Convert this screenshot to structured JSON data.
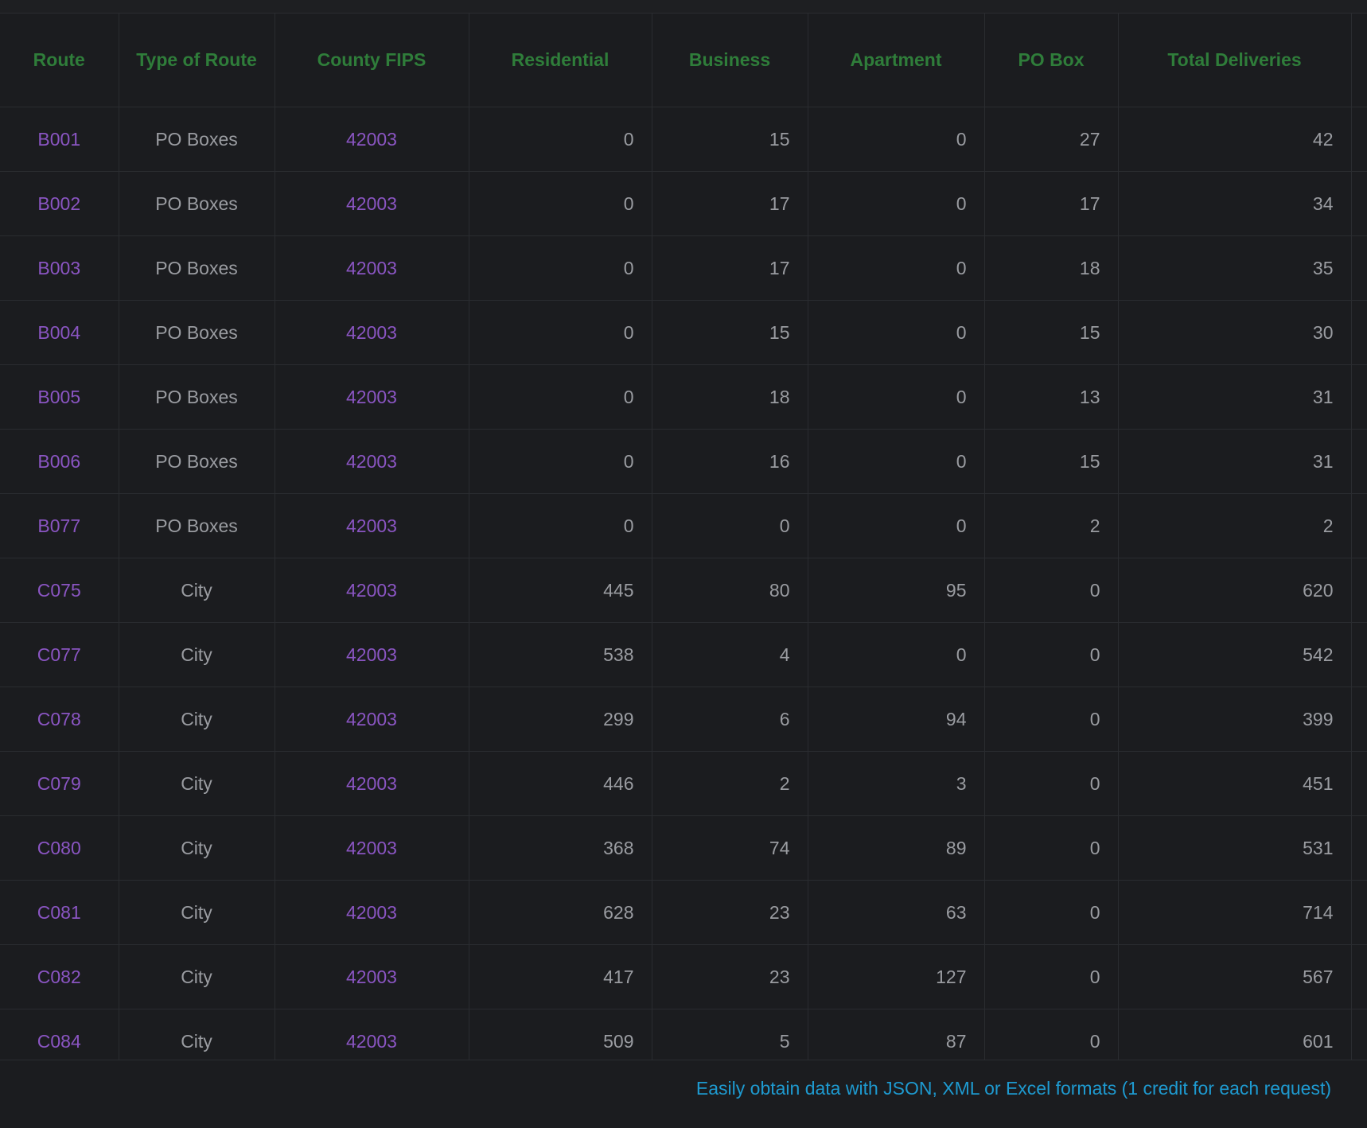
{
  "table": {
    "headers": {
      "route": "Route",
      "type_of_route": "Type of Route",
      "county_fips": "County FIPS",
      "residential": "Residential",
      "business": "Business",
      "apartment": "Apartment",
      "po_box": "PO Box",
      "total_deliveries": "Total Deliveries"
    },
    "rows": [
      {
        "route": "B001",
        "type": "PO Boxes",
        "fips": "42003",
        "residential": "0",
        "business": "15",
        "apartment": "0",
        "po_box": "27",
        "total": "42"
      },
      {
        "route": "B002",
        "type": "PO Boxes",
        "fips": "42003",
        "residential": "0",
        "business": "17",
        "apartment": "0",
        "po_box": "17",
        "total": "34"
      },
      {
        "route": "B003",
        "type": "PO Boxes",
        "fips": "42003",
        "residential": "0",
        "business": "17",
        "apartment": "0",
        "po_box": "18",
        "total": "35"
      },
      {
        "route": "B004",
        "type": "PO Boxes",
        "fips": "42003",
        "residential": "0",
        "business": "15",
        "apartment": "0",
        "po_box": "15",
        "total": "30"
      },
      {
        "route": "B005",
        "type": "PO Boxes",
        "fips": "42003",
        "residential": "0",
        "business": "18",
        "apartment": "0",
        "po_box": "13",
        "total": "31"
      },
      {
        "route": "B006",
        "type": "PO Boxes",
        "fips": "42003",
        "residential": "0",
        "business": "16",
        "apartment": "0",
        "po_box": "15",
        "total": "31"
      },
      {
        "route": "B077",
        "type": "PO Boxes",
        "fips": "42003",
        "residential": "0",
        "business": "0",
        "apartment": "0",
        "po_box": "2",
        "total": "2"
      },
      {
        "route": "C075",
        "type": "City",
        "fips": "42003",
        "residential": "445",
        "business": "80",
        "apartment": "95",
        "po_box": "0",
        "total": "620"
      },
      {
        "route": "C077",
        "type": "City",
        "fips": "42003",
        "residential": "538",
        "business": "4",
        "apartment": "0",
        "po_box": "0",
        "total": "542"
      },
      {
        "route": "C078",
        "type": "City",
        "fips": "42003",
        "residential": "299",
        "business": "6",
        "apartment": "94",
        "po_box": "0",
        "total": "399"
      },
      {
        "route": "C079",
        "type": "City",
        "fips": "42003",
        "residential": "446",
        "business": "2",
        "apartment": "3",
        "po_box": "0",
        "total": "451"
      },
      {
        "route": "C080",
        "type": "City",
        "fips": "42003",
        "residential": "368",
        "business": "74",
        "apartment": "89",
        "po_box": "0",
        "total": "531"
      },
      {
        "route": "C081",
        "type": "City",
        "fips": "42003",
        "residential": "628",
        "business": "23",
        "apartment": "63",
        "po_box": "0",
        "total": "714"
      },
      {
        "route": "C082",
        "type": "City",
        "fips": "42003",
        "residential": "417",
        "business": "23",
        "apartment": "127",
        "po_box": "0",
        "total": "567"
      },
      {
        "route": "C084",
        "type": "City",
        "fips": "42003",
        "residential": "509",
        "business": "5",
        "apartment": "87",
        "po_box": "0",
        "total": "601"
      }
    ]
  },
  "footer": {
    "link_text": "Easily obtain data with JSON, XML or Excel formats (1 credit for each request)"
  },
  "colors": {
    "background": "#1b1c1f",
    "header_text": "#2f7d3a",
    "link_text": "#8a55c2",
    "cell_text": "#9a9ca1",
    "footer_link": "#1e9ad0",
    "grid_line": "#2a2c30"
  }
}
